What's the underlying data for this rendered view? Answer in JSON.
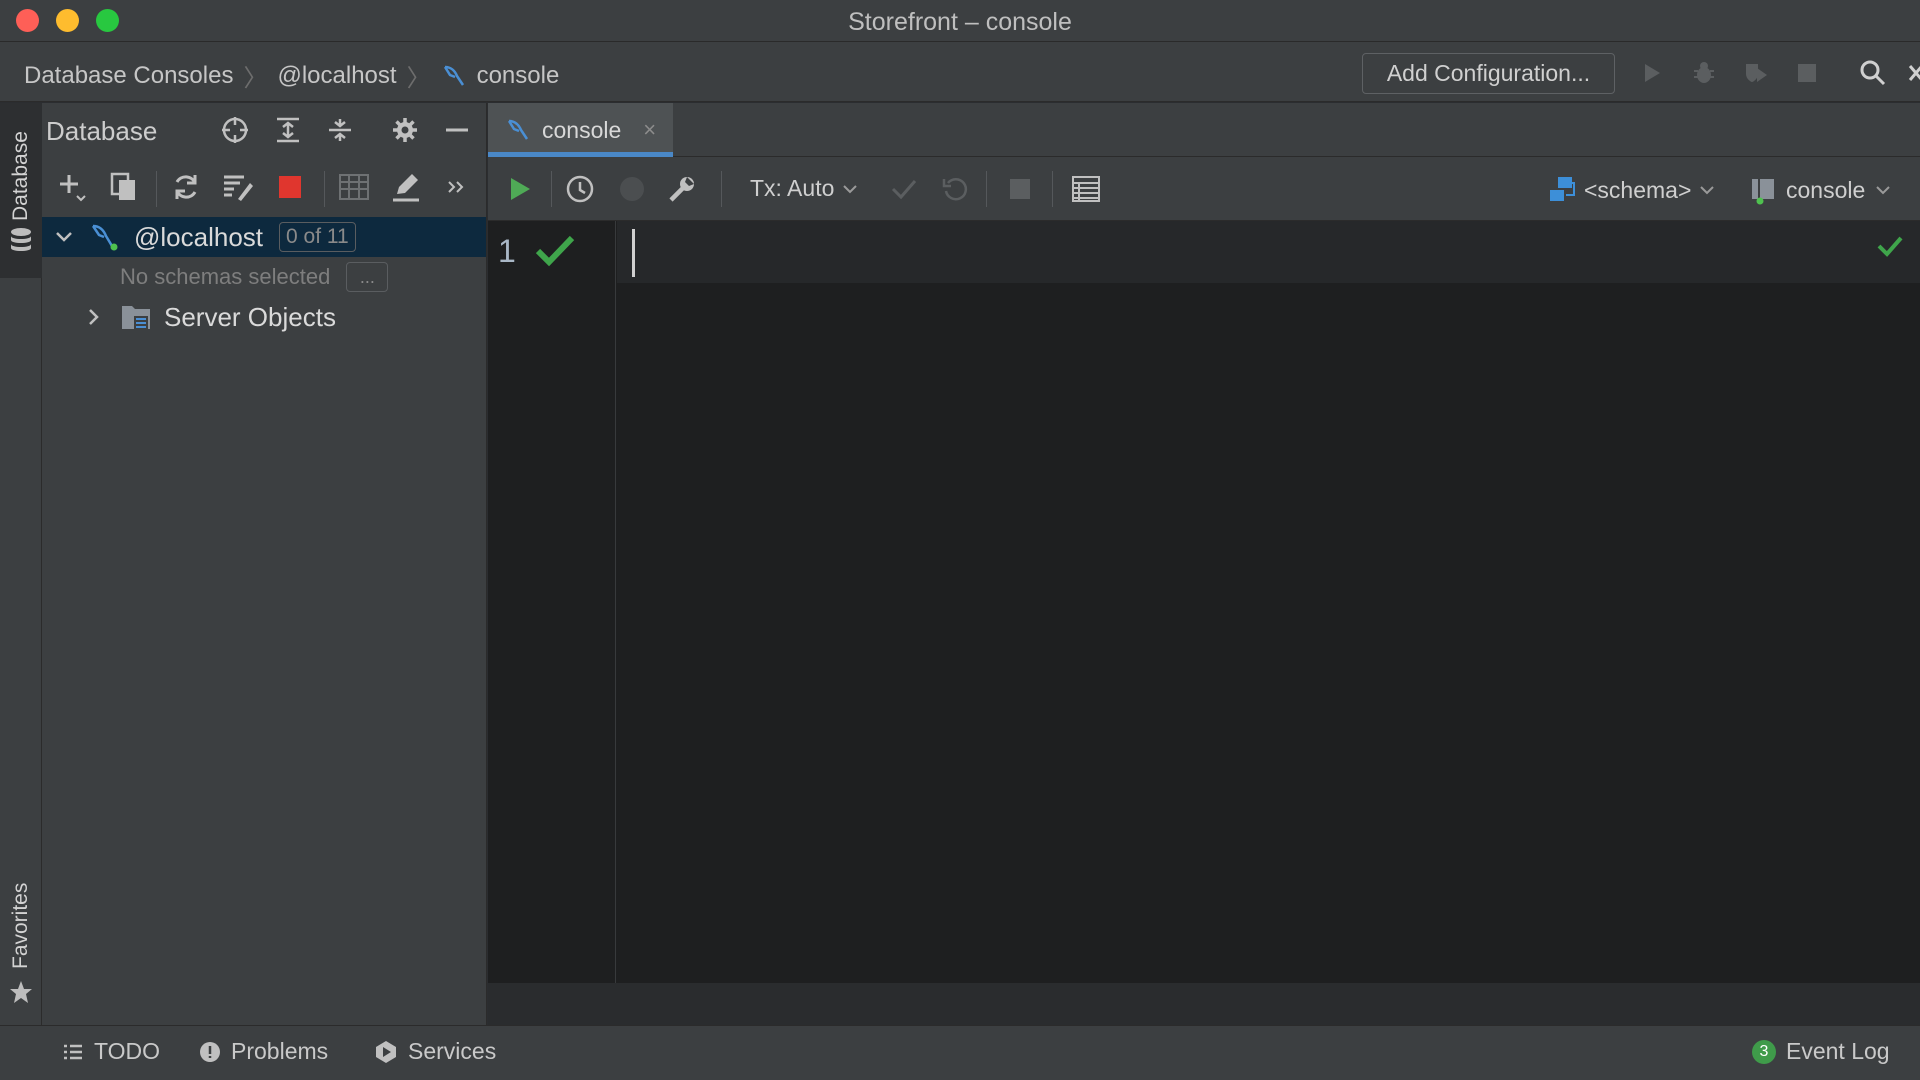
{
  "window": {
    "title": "Storefront – console"
  },
  "breadcrumb": {
    "items": [
      "Database Consoles",
      "@localhost",
      "console"
    ]
  },
  "navbar": {
    "add_configuration": "Add Configuration..."
  },
  "toolstrip": {
    "database": "Database",
    "favorites": "Favorites"
  },
  "db_panel": {
    "title": "Database",
    "tree": {
      "host": {
        "label": "@localhost",
        "badge": "0 of 11"
      },
      "no_schemas": "No schemas selected",
      "ellipsis": "...",
      "server_objects": "Server Objects"
    }
  },
  "editor": {
    "tab": {
      "label": "console",
      "close": "×"
    },
    "toolbar": {
      "tx_mode": "Tx: Auto",
      "schema": "<schema>",
      "session": "console"
    },
    "line_number": "1"
  },
  "bottom": {
    "todo": "TODO",
    "problems": "Problems",
    "services": "Services",
    "event_log": "Event Log",
    "event_count": "3"
  },
  "colors": {
    "run_green": "#4faa56",
    "check_green": "#3fa54b",
    "stop_red": "#e0362e",
    "accent_blue": "#4a88c7",
    "schema_blue": "#3d8fd8"
  }
}
